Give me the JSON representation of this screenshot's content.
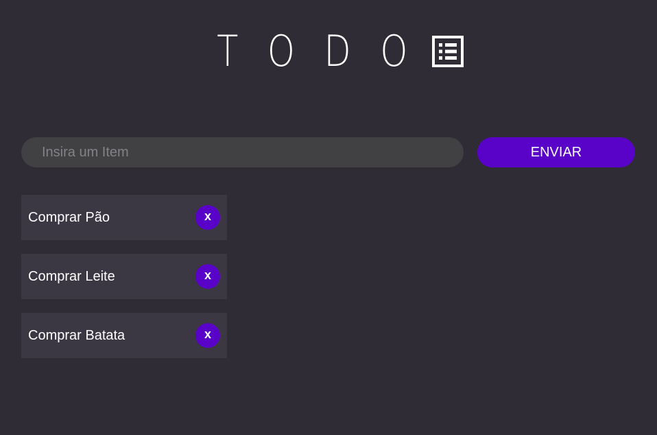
{
  "header": {
    "title": "TODO",
    "icon": "list-icon"
  },
  "form": {
    "placeholder": "Insira um Item",
    "value": "",
    "submit_label": "ENVIAR"
  },
  "todos": [
    {
      "label": "Comprar Pão",
      "delete_label": "x"
    },
    {
      "label": "Comprar Leite",
      "delete_label": "x"
    },
    {
      "label": "Comprar Batata",
      "delete_label": "x"
    }
  ],
  "colors": {
    "background": "#302c36",
    "input_background": "#414043",
    "item_background": "#3c3843",
    "accent": "#5a03c8",
    "text": "#ffffff",
    "placeholder": "#838286"
  }
}
